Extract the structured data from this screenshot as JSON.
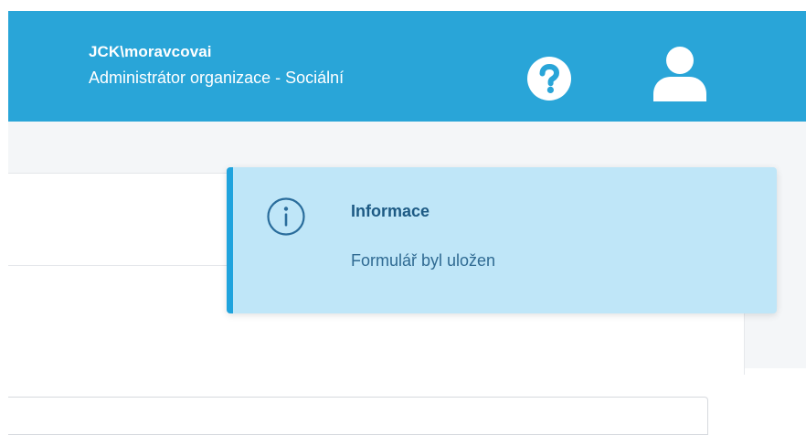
{
  "header": {
    "username": "JCK\\moravcovai",
    "role": "Administrátor organizace - Sociální",
    "help_icon": "question-circle-icon",
    "user_icon": "user-icon",
    "color": "#29a5d8"
  },
  "toast": {
    "icon": "info-icon",
    "title": "Informace",
    "message": "Formulář byl uložen",
    "background": "#bfe6f8",
    "accent": "#1fa3dd"
  }
}
